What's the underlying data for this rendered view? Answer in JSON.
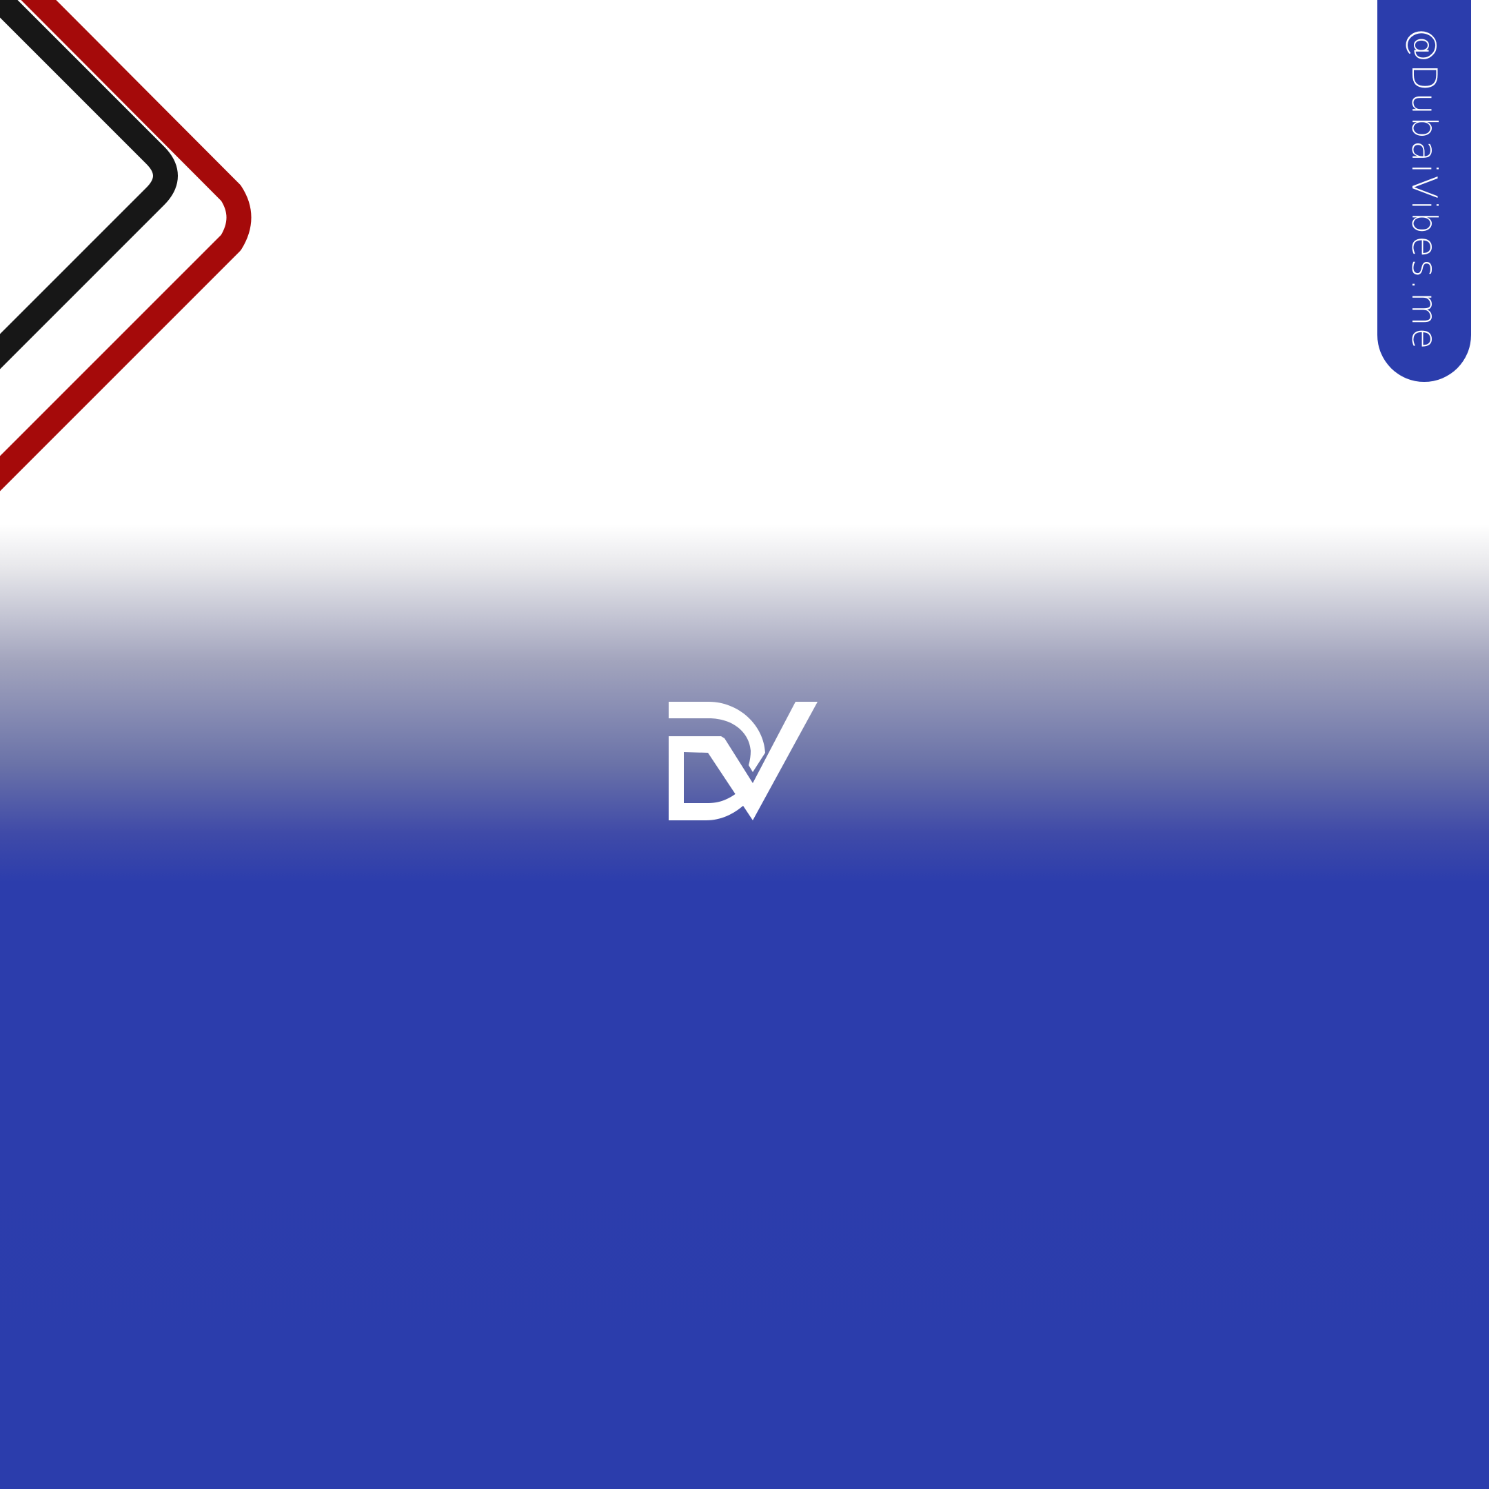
{
  "brand": {
    "handle": "@DubaiVibes.me",
    "logo_icon": "dv-monogram-logo"
  },
  "colors": {
    "primary_blue": "#2b3dac",
    "accent_red": "#a50a0a",
    "accent_black": "#171717",
    "background": "#ffffff"
  }
}
